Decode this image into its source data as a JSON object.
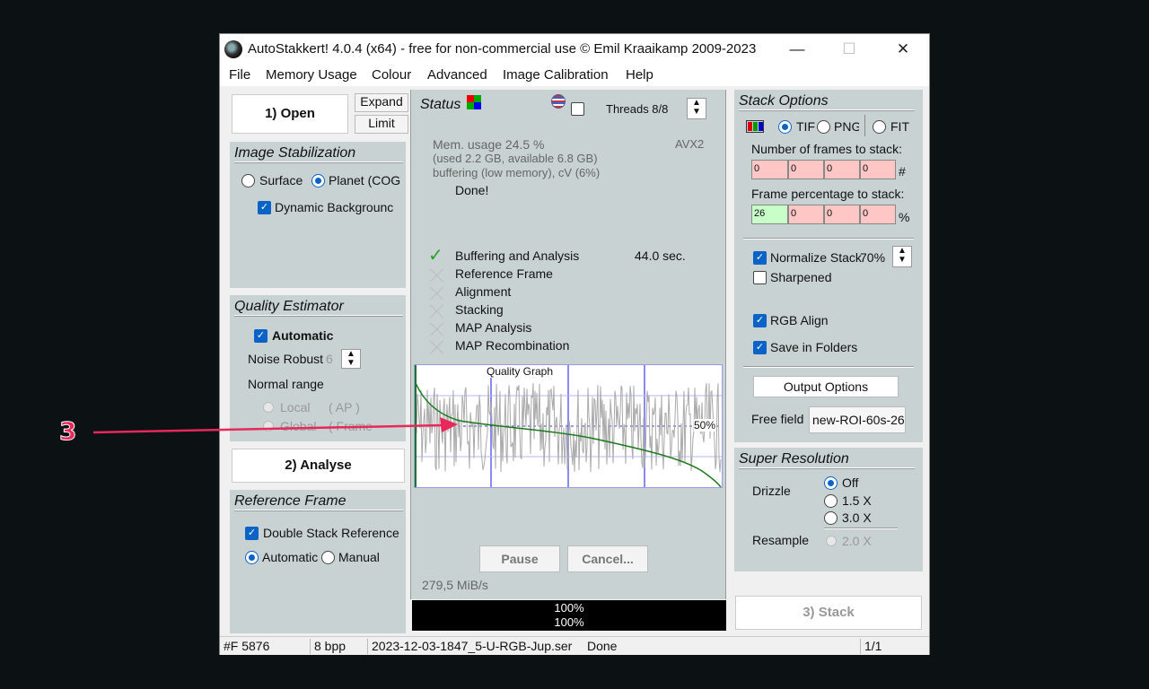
{
  "window": {
    "title": "AutoStakkert! 4.0.4 (x64) - free for non-commercial use © Emil Kraaikamp 2009-2023",
    "minimize": "—",
    "maximize": "☐",
    "close": "✕"
  },
  "menu": [
    "File",
    "Memory Usage",
    "Colour",
    "Advanced",
    "Image Calibration",
    "Help"
  ],
  "left": {
    "open_button": "1) Open",
    "expand_button": "Expand",
    "limit_button": "Limit",
    "stabilization": {
      "title": "Image Stabilization",
      "surface": "Surface",
      "planet": "Planet (COG",
      "dynamic_background": "Dynamic Backgrounc"
    },
    "quality": {
      "title": "Quality Estimator",
      "automatic": "Automatic",
      "noise_robust": "Noise Robust",
      "noise_value": "6",
      "normal_range": "Normal range",
      "local": "Local",
      "local_ap": "( AP )",
      "global": "Global",
      "global_frame": "( Frame"
    },
    "analyse_button": "2) Analyse",
    "reference": {
      "title": "Reference Frame",
      "double_stack": "Double Stack Reference",
      "automatic": "Automatic",
      "manual": "Manual"
    }
  },
  "center": {
    "status_title": "Status",
    "threads": "Threads 8/8",
    "mem_usage": "Mem. usage 24.5 %",
    "mem_detail": "(used 2.2 GB, available 6.8 GB)",
    "buffering": "buffering (low memory), cV (6%)",
    "avx": "AVX2",
    "done": "Done!",
    "steps": [
      {
        "label": "Buffering and Analysis",
        "time": "44.0 sec.",
        "done": true
      },
      {
        "label": "Reference Frame",
        "time": "",
        "done": false
      },
      {
        "label": "Alignment",
        "time": "",
        "done": false
      },
      {
        "label": "Stacking",
        "time": "",
        "done": false
      },
      {
        "label": "MAP Analysis",
        "time": "",
        "done": false
      },
      {
        "label": "MAP Recombination",
        "time": "",
        "done": false
      }
    ],
    "graph_title": "Quality Graph",
    "graph_marker": "50%",
    "pause_button": "Pause",
    "cancel_button": "Cancel...",
    "speed": "279,5 MiB/s",
    "progress_1": "100%",
    "progress_2": "100%"
  },
  "right": {
    "stack_options": {
      "title": "Stack Options",
      "tif": "TIF",
      "png": "PNG",
      "fit": "FIT",
      "frames_label": "Number of frames to stack:",
      "frames": [
        "0",
        "0",
        "0",
        "0"
      ],
      "frames_unit": "#",
      "percent_label": "Frame percentage to stack:",
      "percents": [
        "26",
        "0",
        "0",
        "0"
      ],
      "percent_unit": "%",
      "normalize": "Normalize Stack",
      "normalize_value": "70%",
      "sharpened": "Sharpened",
      "rgb_align": "RGB Align",
      "save_folders": "Save in Folders",
      "output_options": "Output Options",
      "free_field_label": "Free field",
      "free_field_value": "new-ROI-60s-26"
    },
    "super_resolution": {
      "title": "Super Resolution",
      "drizzle": "Drizzle",
      "off": "Off",
      "x15": "1.5 X",
      "x30": "3.0 X",
      "resample": "Resample",
      "x20": "2.0 X"
    },
    "stack_button": "3) Stack"
  },
  "statusbar": {
    "frames": "#F 5876",
    "bpp": "8 bpp",
    "file": "2023-12-03-1847_5-U-RGB-Jup.ser",
    "state": "Done",
    "page": "1/1"
  },
  "annotation": {
    "label": "3",
    "color": "#e8275a"
  }
}
